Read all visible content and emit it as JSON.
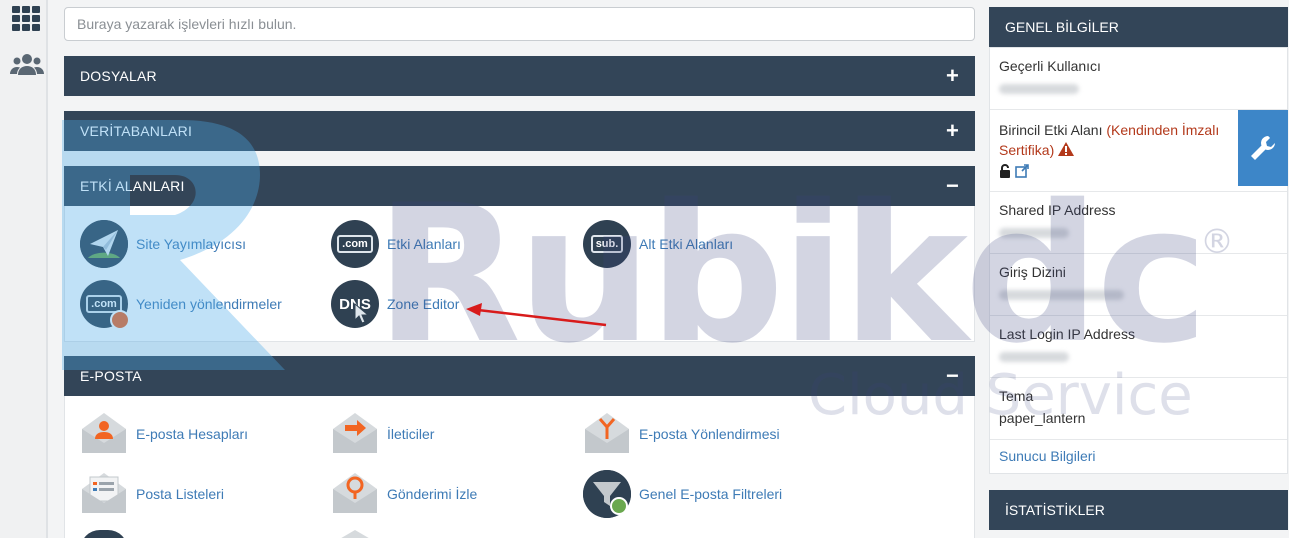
{
  "search": {
    "placeholder": "Buraya yazarak işlevleri hızlı bulun."
  },
  "sections": {
    "files": {
      "title": "DOSYALAR",
      "toggle": "+"
    },
    "databases": {
      "title": "VERİTABANLARI",
      "toggle": "+"
    },
    "domains": {
      "title": "ETKİ ALANLARI",
      "toggle": "−",
      "items": [
        {
          "label": "Site Yayımlayıcısı"
        },
        {
          "label": "Etki Alanları",
          "badge": ".com"
        },
        {
          "label": "Alt Etki Alanları",
          "badge": "sub."
        },
        {
          "label": "Yeniden yönlendirmeler",
          "badge": ".com"
        },
        {
          "label": "Zone Editor",
          "badge": "DNS"
        }
      ]
    },
    "email": {
      "title": "E-POSTA",
      "toggle": "−",
      "items": [
        {
          "label": "E-posta Hesapları"
        },
        {
          "label": "İleticiler"
        },
        {
          "label": "E-posta Yönlendirmesi"
        },
        {
          "label": "Posta Listeleri"
        },
        {
          "label": "Gönderimi İzle"
        },
        {
          "label": "Genel E-posta Filtreleri"
        }
      ]
    }
  },
  "general_info": {
    "title": "GENEL BİLGİLER",
    "current_user_label": "Geçerli Kullanıcı",
    "primary_domain_label": "Birincil Etki Alanı",
    "cert_warning": "(Kendinden İmzalı Sertifika)",
    "shared_ip_label": "Shared IP Address",
    "home_dir_label": "Giriş Dizini",
    "last_login_label": "Last Login IP Address",
    "theme_label": "Tema",
    "theme_value": "paper_lantern",
    "server_info_link": "Sunucu Bilgileri"
  },
  "stats": {
    "title": "İSTATİSTİKLER"
  },
  "watermark": {
    "brand": "Rubikdc",
    "tagline": "Cloud Service",
    "reg": "®"
  },
  "colors": {
    "header": "#334558",
    "link": "#3e7bb6",
    "accent": "#3d86c8",
    "warning": "#b3391b",
    "arrow": "#d81b1b"
  }
}
